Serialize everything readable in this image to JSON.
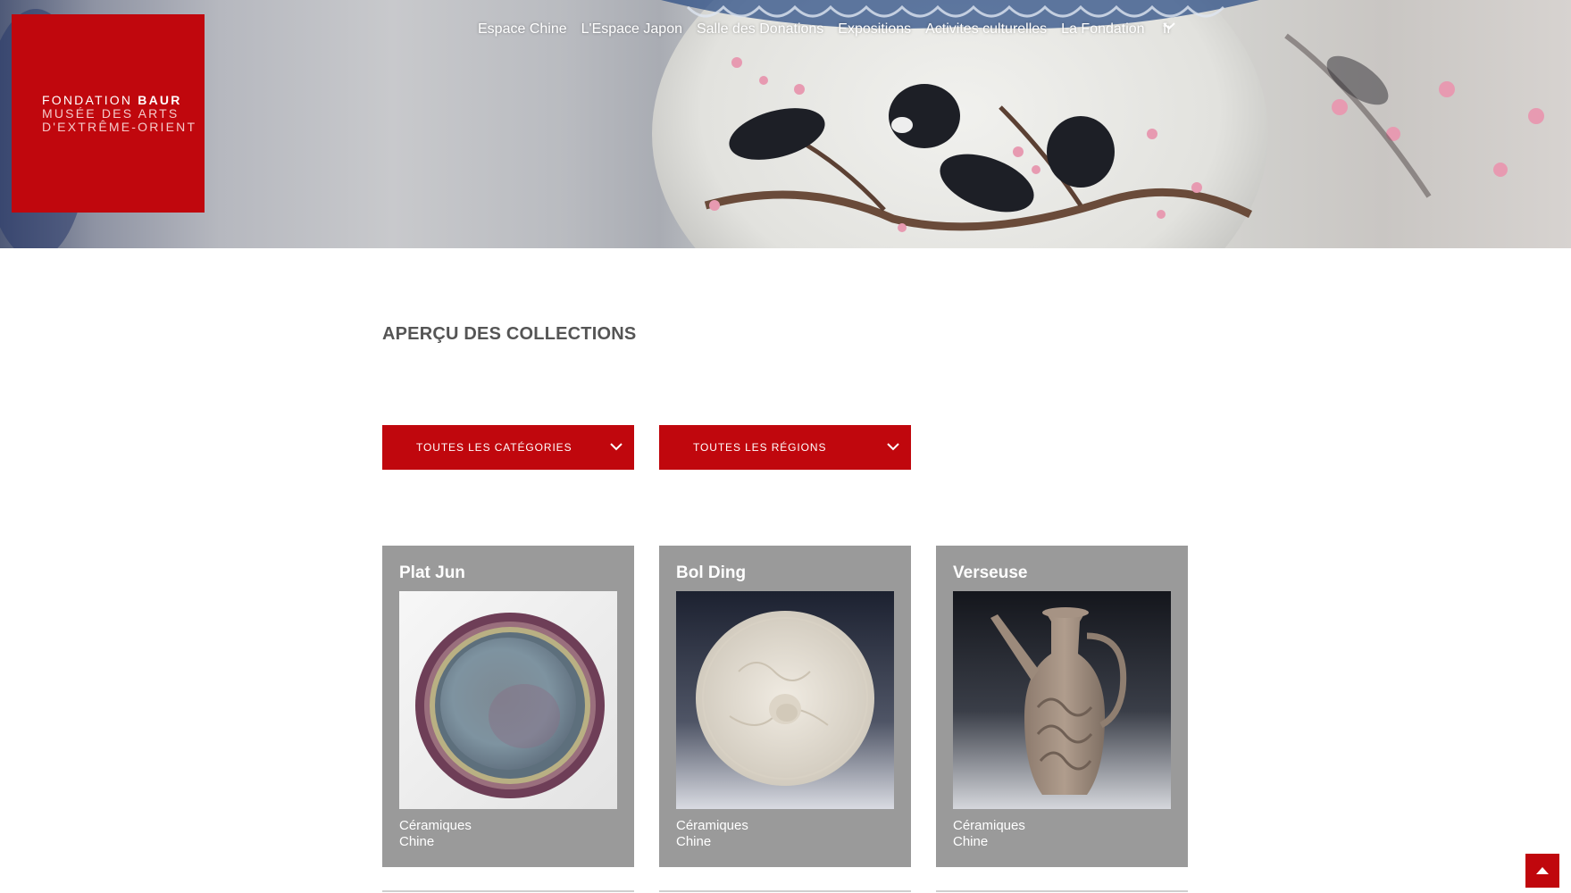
{
  "site": {
    "logo_line1_light": "FONDATION ",
    "logo_line1_bold": "BAUR",
    "logo_line2": "MUSÉE DES ARTS",
    "logo_line3": "D'EXTRÊME-ORIENT"
  },
  "nav": {
    "items": [
      {
        "label": "Espace Chine"
      },
      {
        "label": "L'Espace Japon"
      },
      {
        "label": "Salle des Donations"
      },
      {
        "label": "Expositions"
      },
      {
        "label": "Activites culturelles"
      },
      {
        "label": "La Fondation"
      }
    ],
    "language": "fr",
    "language_icon": "chevron-down-icon"
  },
  "main": {
    "title": "APERÇU DES COLLECTIONS",
    "filters": {
      "category": "TOUTES LES CATÉGORIES",
      "region": "TOUTES LES RÉGIONS"
    },
    "cards": [
      {
        "title": "Plat Jun",
        "category": "Céramiques",
        "region": "Chine"
      },
      {
        "title": "Bol Ding",
        "category": "Céramiques",
        "region": "Chine"
      },
      {
        "title": "Verseuse",
        "category": "Céramiques",
        "region": "Chine"
      }
    ]
  },
  "colors": {
    "brand_red": "#c0070d",
    "card_grey": "#9a9a9a"
  },
  "icons": {
    "back_to_top": "arrow-up-icon"
  }
}
